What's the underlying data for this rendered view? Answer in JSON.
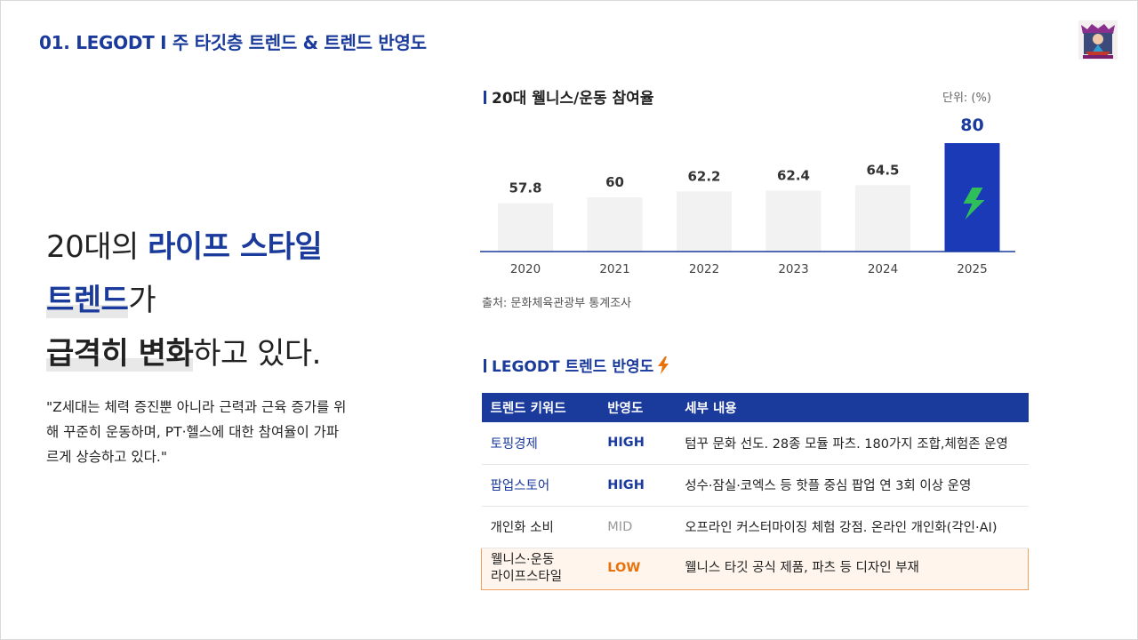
{
  "slide": {
    "title": "01. LEGODT I 주 타깃층 트렌드 & 트렌드 반영도"
  },
  "headline": {
    "line1_plain": "20대의 ",
    "line1_blue": "라이프 스타일",
    "line2_blue": "트렌드",
    "line2_plain": "가",
    "line3_bold": "급격히 변화",
    "line3_plain": "하고 있다."
  },
  "quote": "\"Z세대는 체력 증진뿐 아니라 근력과 근육 증가를 위해 꾸준히 운동하며, PT·헬스에 대한 참여율이 가파르게 상승하고 있다.\"",
  "chart_section": {
    "title": "20대 웰니스/운동 참여율",
    "unit": "단위: (%)",
    "source": "출처: 문화체육관광부 통계조사"
  },
  "chart_data": {
    "type": "bar",
    "title": "20대 웰니스/운동 참여율",
    "categories": [
      "2020",
      "2021",
      "2022",
      "2023",
      "2024",
      "2025"
    ],
    "values": [
      57.8,
      60,
      62.2,
      62.4,
      64.5,
      80
    ],
    "value_labels": [
      "57.8",
      "60",
      "62.2",
      "62.4",
      "64.5",
      "80"
    ],
    "ylabel": "단위: (%)",
    "highlight_index": 5,
    "colors": {
      "normal": "#f2f2f2",
      "highlight": "#1a3ab8",
      "label": "#333333",
      "highlight_label": "#1a3a9c",
      "bolt": "#2fbf5a"
    },
    "grid": false
  },
  "table_section": {
    "title": "LEGODT 트렌드 반영도",
    "bolt_icon": "lightning-icon",
    "headers": [
      "트렌드 키워드",
      "반영도",
      "세부 내용"
    ],
    "rows": [
      {
        "keyword": "토핑경제",
        "level": "HIGH",
        "detail": "텀꾸 문화 선도. 28종 모듈 파츠. 180가지 조합,체험존 운영"
      },
      {
        "keyword": "팝업스토어",
        "level": "HIGH",
        "detail": "성수·잠실·코엑스 등 핫플 중심 팝업 연 3회 이상 운영"
      },
      {
        "keyword": "개인화 소비",
        "level": "MID",
        "detail": "오프라인 커스터마이징 체험 강점. 온라인 개인화(각인·AI)"
      },
      {
        "keyword_line1": "웰니스·운동",
        "keyword_line2": "라이프스타일",
        "level": "LOW",
        "detail": "웰니스 타깃 공식 제품, 파츠 등 디자인 부재"
      }
    ]
  },
  "colors": {
    "brand": "#1a3a9c",
    "accent_orange": "#e8730e"
  }
}
